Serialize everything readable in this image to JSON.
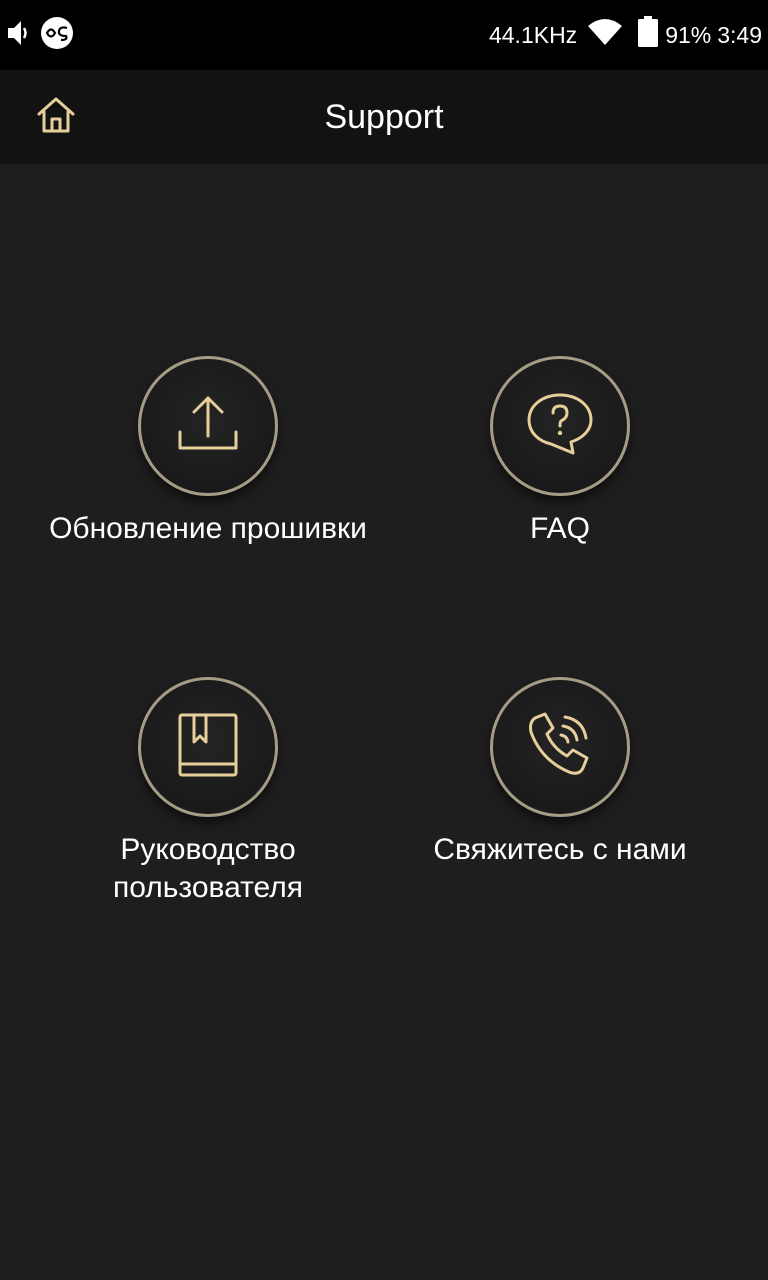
{
  "status_bar": {
    "sample_rate": "44.1KHz",
    "battery_percent": "91%",
    "time": "3:49",
    "icons": [
      "volume-icon",
      "app-logo-icon",
      "wifi-icon",
      "battery-icon"
    ]
  },
  "app_bar": {
    "title": "Support",
    "home_icon": "home-icon"
  },
  "colors": {
    "accent_gold": "#e6cf9a",
    "ring": "#a59c86",
    "background": "#1e1e1e",
    "app_bar": "#121212",
    "status_bar": "#000000"
  },
  "menu": {
    "firmware_update": {
      "label": "Обновление прошивки",
      "icon": "upload-icon"
    },
    "faq": {
      "label": "FAQ",
      "icon": "question-bubble-icon"
    },
    "user_manual": {
      "label": "Руководство\nпользователя",
      "icon": "book-icon"
    },
    "contact_us": {
      "label": "Свяжитесь с нами",
      "icon": "phone-icon"
    }
  }
}
